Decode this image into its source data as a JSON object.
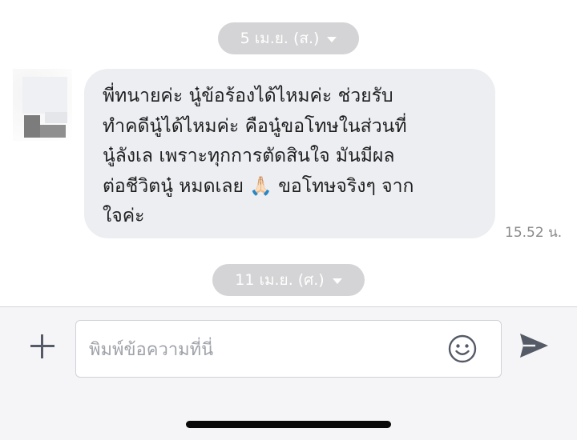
{
  "chat": {
    "date_separators": [
      {
        "label": "5 เม.ย. (ส.)"
      },
      {
        "label": "11 เม.ย. (ศ.)"
      }
    ],
    "messages": [
      {
        "text": "พี่ทนายค่ะ นู๋ข้อร้องได้ไหมค่ะ ช่วยรับ\nทำคดีนู๋ได้ไหมค่ะ คือนู๋ขอโทษในส่วนที่\nนู๋ลังเล เพราะทุกการตัดสินใจ มันมีผล\nต่อชีวิตนู๋ หมดเลย 🙏🏻 ขอโทษจริงๆ จาก\nใจค่ะ",
        "time": "15.52 น."
      }
    ]
  },
  "composer": {
    "placeholder": "พิมพ์ข้อความที่นี่",
    "value": ""
  },
  "icons": {
    "add": "plus-icon",
    "emoji": "smiley-icon",
    "send": "send-arrow-icon"
  },
  "colors": {
    "incoming_bubble": "#eceef2",
    "date_pill": "#d4d4d6",
    "icon_gray": "#555b66"
  }
}
